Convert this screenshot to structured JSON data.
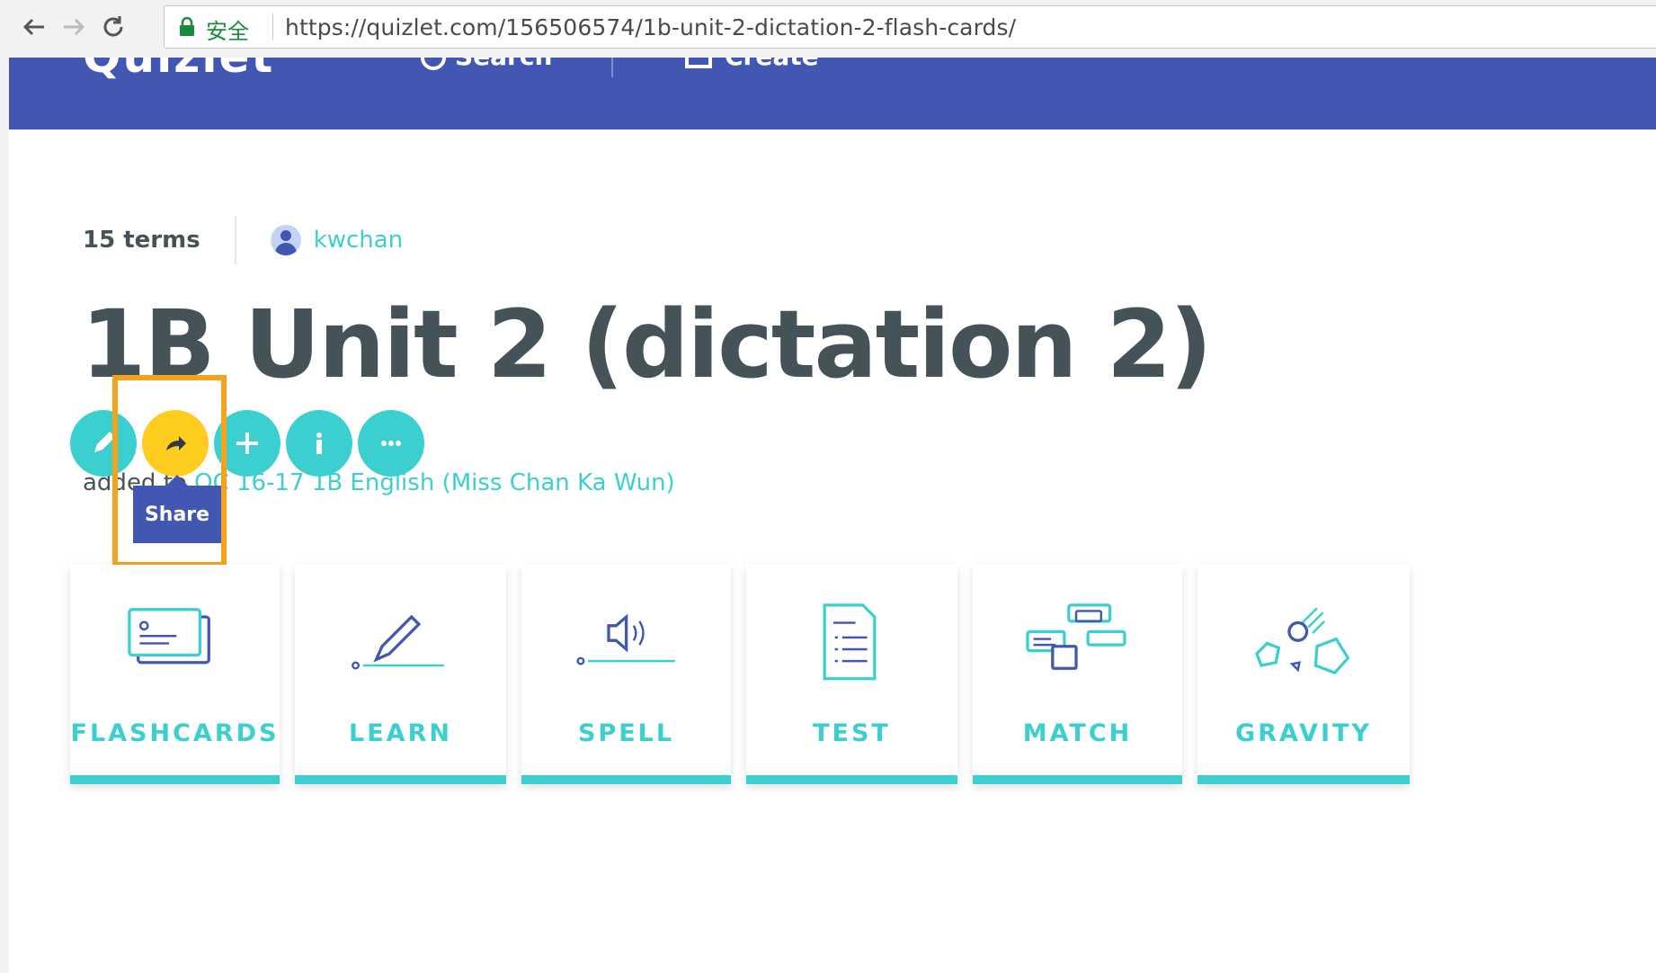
{
  "browser": {
    "secure_label": "安全",
    "url": "https://quizlet.com/156506574/1b-unit-2-dictation-2-flash-cards/"
  },
  "nav": {
    "logo": "Quizlet",
    "search": "Search",
    "create": "Create"
  },
  "set": {
    "terms": "15 terms",
    "author": "kwchan",
    "title": "1B Unit 2 (dictation 2)",
    "added_to_prefix": "added to ",
    "class_name": "QC 16-17 1B English (Miss Chan Ka Wun)"
  },
  "actions": {
    "share_tooltip": "Share"
  },
  "modes": [
    {
      "label": "FLASHCARDS",
      "icon": "flashcards-icon"
    },
    {
      "label": "LEARN",
      "icon": "learn-icon"
    },
    {
      "label": "SPELL",
      "icon": "spell-icon"
    },
    {
      "label": "TEST",
      "icon": "test-icon"
    },
    {
      "label": "MATCH",
      "icon": "match-icon"
    },
    {
      "label": "GRAVITY",
      "icon": "gravity-icon"
    }
  ],
  "colors": {
    "brand": "#4257b2",
    "accent": "#3ccfcf",
    "share": "#ffcd1f",
    "highlight": "#f5a31a",
    "text": "#455358"
  }
}
